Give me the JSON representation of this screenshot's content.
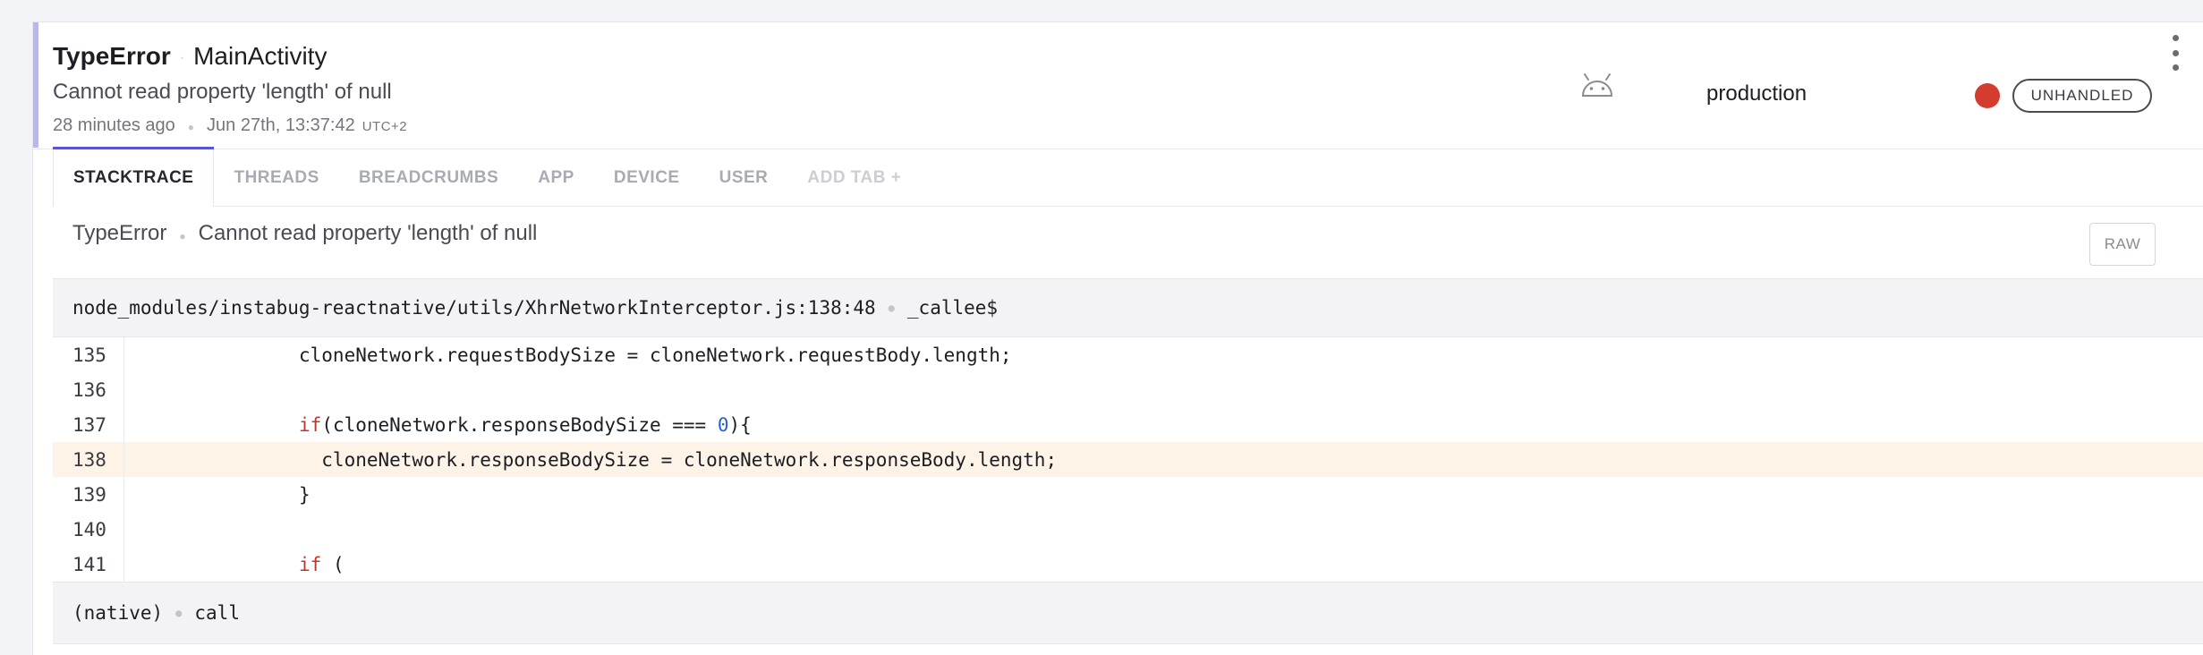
{
  "header": {
    "error_type": "TypeError",
    "activity": "MainActivity",
    "message": "Cannot read property 'length' of null",
    "relative_time": "28 minutes ago",
    "timestamp": "Jun 27th, 13:37:42",
    "timezone": "UTC+2",
    "platform_icon": "android-icon",
    "environment": "production",
    "severity_color": "#d43c2f",
    "handled_badge": "UNHANDLED",
    "menu_icon": "kebab-menu-icon"
  },
  "tabs": [
    {
      "label": "STACKTRACE",
      "active": true
    },
    {
      "label": "THREADS"
    },
    {
      "label": "BREADCRUMBS"
    },
    {
      "label": "APP"
    },
    {
      "label": "DEVICE"
    },
    {
      "label": "USER"
    },
    {
      "label": "ADD TAB +"
    }
  ],
  "exception": {
    "type": "TypeError",
    "message": "Cannot read property 'length' of null",
    "raw_button": "RAW"
  },
  "frames": [
    {
      "file": "node_modules/instabug-reactnative/utils/XhrNetworkInterceptor.js:138:48",
      "method": "_callee$",
      "lines": [
        {
          "num": "135",
          "pre": "              cloneNetwork.requestBodySize = cloneNetwork.requestBody.length;",
          "kw": "",
          "mid": "",
          "numlit": "",
          "post": ""
        },
        {
          "num": "136",
          "pre": "",
          "kw": "",
          "mid": "",
          "numlit": "",
          "post": ""
        },
        {
          "num": "137",
          "pre": "              ",
          "kw": "if",
          "mid": "(cloneNetwork.responseBodySize === ",
          "numlit": "0",
          "post": "){"
        },
        {
          "num": "138",
          "pre": "                cloneNetwork.responseBodySize = cloneNetwork.responseBody.length;",
          "kw": "",
          "mid": "",
          "numlit": "",
          "post": "",
          "highlight": true
        },
        {
          "num": "139",
          "pre": "              }",
          "kw": "",
          "mid": "",
          "numlit": "",
          "post": ""
        },
        {
          "num": "140",
          "pre": "",
          "kw": "",
          "mid": "",
          "numlit": "",
          "post": ""
        },
        {
          "num": "141",
          "pre": "              ",
          "kw": "if",
          "mid": " (",
          "numlit": "",
          "post": ""
        }
      ]
    },
    {
      "file": "(native)",
      "method": "call"
    }
  ],
  "colors": {
    "accent": "#5855d6",
    "highlight_line": "#fdf3e6",
    "keyword": "#c5332b",
    "number": "#2a60d0"
  }
}
